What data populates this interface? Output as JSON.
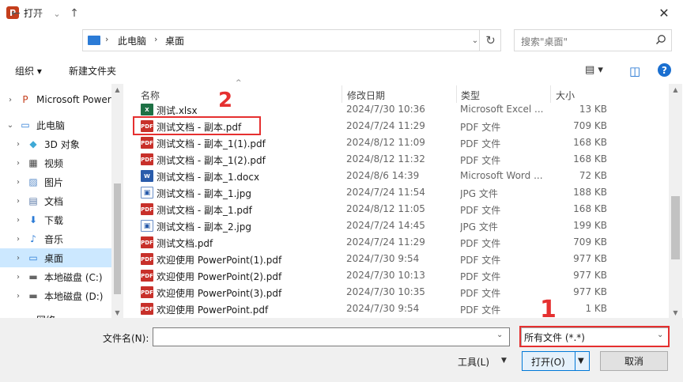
{
  "window": {
    "title": "打开",
    "app_icon_letter": "P",
    "close_glyph": "✕"
  },
  "nav": {
    "back": "←",
    "forward": "→",
    "recent": "⌄",
    "up": "↑",
    "breadcrumb": [
      "此电脑",
      "桌面"
    ],
    "crumb_sep": "›",
    "refresh": "↻",
    "search_placeholder": "搜索\"桌面\""
  },
  "toolbar": {
    "organize": "组织 ▾",
    "new_folder": "新建文件夹",
    "view_icon": "▤ ▾",
    "pane_icon": "◫",
    "help": "?"
  },
  "sidebar": {
    "items": [
      {
        "label": "Microsoft Power",
        "chev": "›",
        "icon": "P",
        "icon_color": "#c43e1c"
      },
      {
        "label": "此电脑",
        "chev": "⌄",
        "icon": "▭",
        "icon_color": "#2b7bd6"
      },
      {
        "label": "3D 对象",
        "chev": "›",
        "icon": "◆",
        "icon_color": "#3fa9d6"
      },
      {
        "label": "视频",
        "chev": "›",
        "icon": "▦",
        "icon_color": "#444444"
      },
      {
        "label": "图片",
        "chev": "›",
        "icon": "▨",
        "icon_color": "#5a8cc8"
      },
      {
        "label": "文档",
        "chev": "›",
        "icon": "▤",
        "icon_color": "#5a7aa8"
      },
      {
        "label": "下载",
        "chev": "›",
        "icon": "⬇",
        "icon_color": "#2b7bd6"
      },
      {
        "label": "音乐",
        "chev": "›",
        "icon": "♪",
        "icon_color": "#2b7bd6"
      },
      {
        "label": "桌面",
        "chev": "›",
        "icon": "▭",
        "icon_color": "#2b7bd6",
        "selected": true
      },
      {
        "label": "本地磁盘 (C:)",
        "chev": "›",
        "icon": "▬",
        "icon_color": "#666666"
      },
      {
        "label": "本地磁盘 (D:)",
        "chev": "›",
        "icon": "▬",
        "icon_color": "#666666"
      },
      {
        "label": "网络",
        "chev": "›",
        "icon": "▭",
        "icon_color": "#2b7bd6"
      }
    ]
  },
  "columns": {
    "name": "名称",
    "date": "修改日期",
    "type": "类型",
    "size": "大小",
    "sort_arrow": "^"
  },
  "files": [
    {
      "name": "测试.xlsx",
      "kind": "xlsx",
      "badge": "X",
      "date": "2024/7/30 10:36",
      "type": "Microsoft Excel ...",
      "size": "13 KB"
    },
    {
      "name": "测试文档 - 副本.pdf",
      "kind": "pdf",
      "badge": "PDF",
      "date": "2024/7/24 11:29",
      "type": "PDF 文件",
      "size": "709 KB"
    },
    {
      "name": "测试文档 - 副本_1(1).pdf",
      "kind": "pdf",
      "badge": "PDF",
      "date": "2024/8/12 11:09",
      "type": "PDF 文件",
      "size": "168 KB"
    },
    {
      "name": "测试文档 - 副本_1(2).pdf",
      "kind": "pdf",
      "badge": "PDF",
      "date": "2024/8/12 11:32",
      "type": "PDF 文件",
      "size": "168 KB"
    },
    {
      "name": "测试文档 - 副本_1.docx",
      "kind": "docx",
      "badge": "W",
      "date": "2024/8/6 14:39",
      "type": "Microsoft Word ...",
      "size": "72 KB"
    },
    {
      "name": "测试文档 - 副本_1.jpg",
      "kind": "jpg",
      "badge": "▣",
      "date": "2024/7/24 11:54",
      "type": "JPG 文件",
      "size": "188 KB"
    },
    {
      "name": "测试文档 - 副本_1.pdf",
      "kind": "pdf",
      "badge": "PDF",
      "date": "2024/8/12 11:05",
      "type": "PDF 文件",
      "size": "168 KB"
    },
    {
      "name": "测试文档 - 副本_2.jpg",
      "kind": "jpg",
      "badge": "▣",
      "date": "2024/7/24 14:45",
      "type": "JPG 文件",
      "size": "199 KB"
    },
    {
      "name": "测试文档.pdf",
      "kind": "pdf",
      "badge": "PDF",
      "date": "2024/7/24 11:29",
      "type": "PDF 文件",
      "size": "709 KB"
    },
    {
      "name": "欢迎使用 PowerPoint(1).pdf",
      "kind": "pdf",
      "badge": "PDF",
      "date": "2024/7/30 9:54",
      "type": "PDF 文件",
      "size": "977 KB"
    },
    {
      "name": "欢迎使用 PowerPoint(2).pdf",
      "kind": "pdf",
      "badge": "PDF",
      "date": "2024/7/30 10:13",
      "type": "PDF 文件",
      "size": "977 KB"
    },
    {
      "name": "欢迎使用 PowerPoint(3).pdf",
      "kind": "pdf",
      "badge": "PDF",
      "date": "2024/7/30 10:35",
      "type": "PDF 文件",
      "size": "977 KB"
    },
    {
      "name": "欢迎使用 PowerPoint.pdf",
      "kind": "pdf",
      "badge": "PDF",
      "date": "2024/7/30 9:54",
      "type": "PDF 文件",
      "size": "1 KB"
    }
  ],
  "bottom": {
    "filename_label": "文件名(N):",
    "filename_value": "",
    "filter": "所有文件 (*.*)",
    "tools": "工具(L)",
    "open": "打开(O)",
    "cancel": "取消",
    "dd": "⌄"
  },
  "annotations": {
    "one": "1",
    "two": "2",
    "color": "#e53030"
  }
}
